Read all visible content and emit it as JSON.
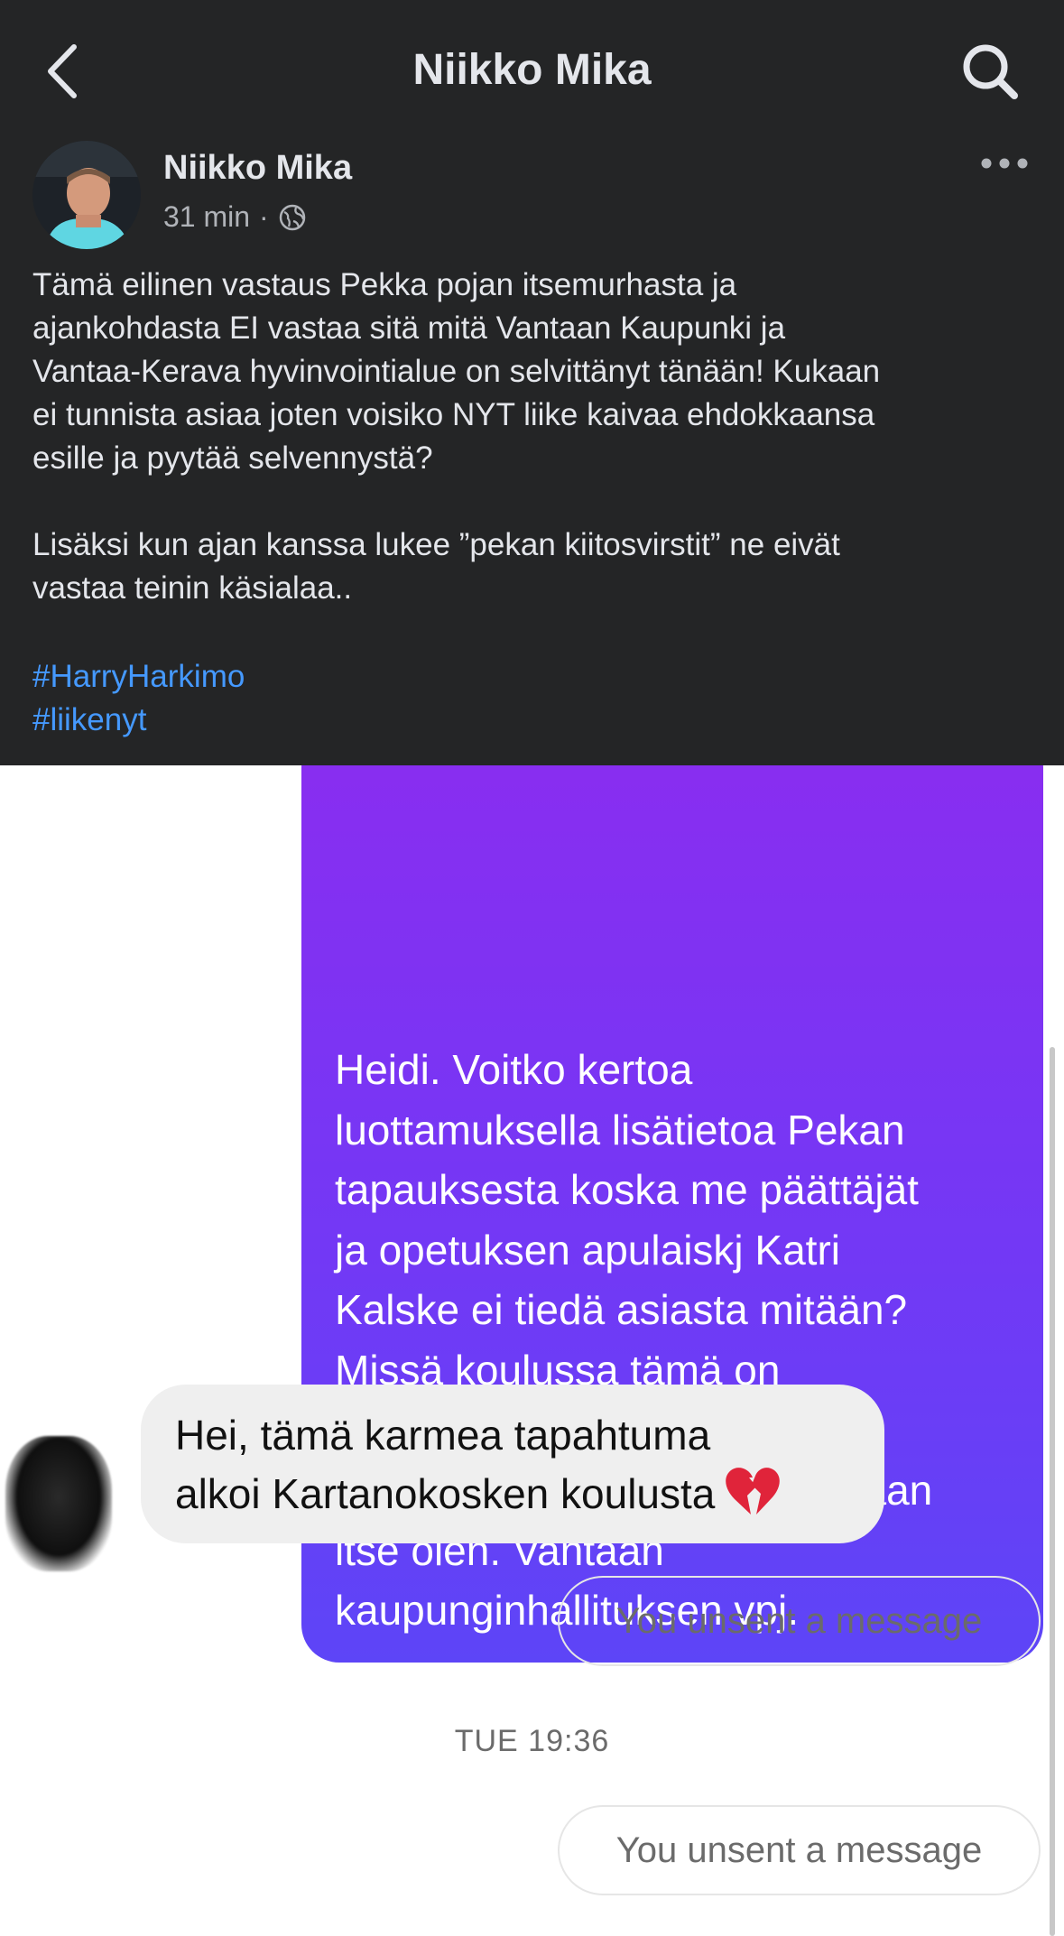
{
  "header": {
    "title": "Niikko Mika"
  },
  "post": {
    "author": "Niikko Mika",
    "time": "31 min",
    "separator": "·",
    "visibility_icon": "globe-icon",
    "body": "Tämä eilinen vastaus Pekka pojan itsemurhasta ja\najankohdasta EI vastaa sitä mitä Vantaan Kaupunki ja\nVantaa-Kerava hyvinvointialue on selvittänyt tänään! Kukaan\nei tunnista asiaa joten voisiko NYT liike kaivaa ehdokkaansa\nesille ja pyytää selvennystä?\n\nLisäksi kun ajan kanssa lukee ”pekan kiitosvirstit” ne eivät\nvastaa teinin käsialaa..",
    "hashtags": [
      "#HarryHarkimo",
      "#liikenyt"
    ]
  },
  "chat": {
    "sent_message": "Heidi. Voitko kertoa\nluottamuksella lisätietoa Pekan\ntapauksesta koska me päättäjät\nja opetuksen apulaiskj Katri\nKalske ei tiedä asiasta mitään?\nMissä koulussa tämä on\ntapahtunut ja milloin? Näillä\ntiedoilla pääsemme kiinni asiaan\nitse olen. Vantaan\nkaupunginhallituksen vpj.",
    "received_message": "Hei, tämä karmea tapahtuma\nalkoi Kartanokosken koulusta",
    "received_emoji": "broken-heart-icon",
    "unsent_1": "You unsent a message",
    "timestamp": "TUE 19:36",
    "unsent_2": "You unsent a message"
  },
  "colors": {
    "post_background": "#242526",
    "hashtag": "#4599ff",
    "bubble_gradient_top": "#8a2df0",
    "bubble_gradient_bottom": "#5d45f7",
    "received_bubble": "#efefef"
  }
}
